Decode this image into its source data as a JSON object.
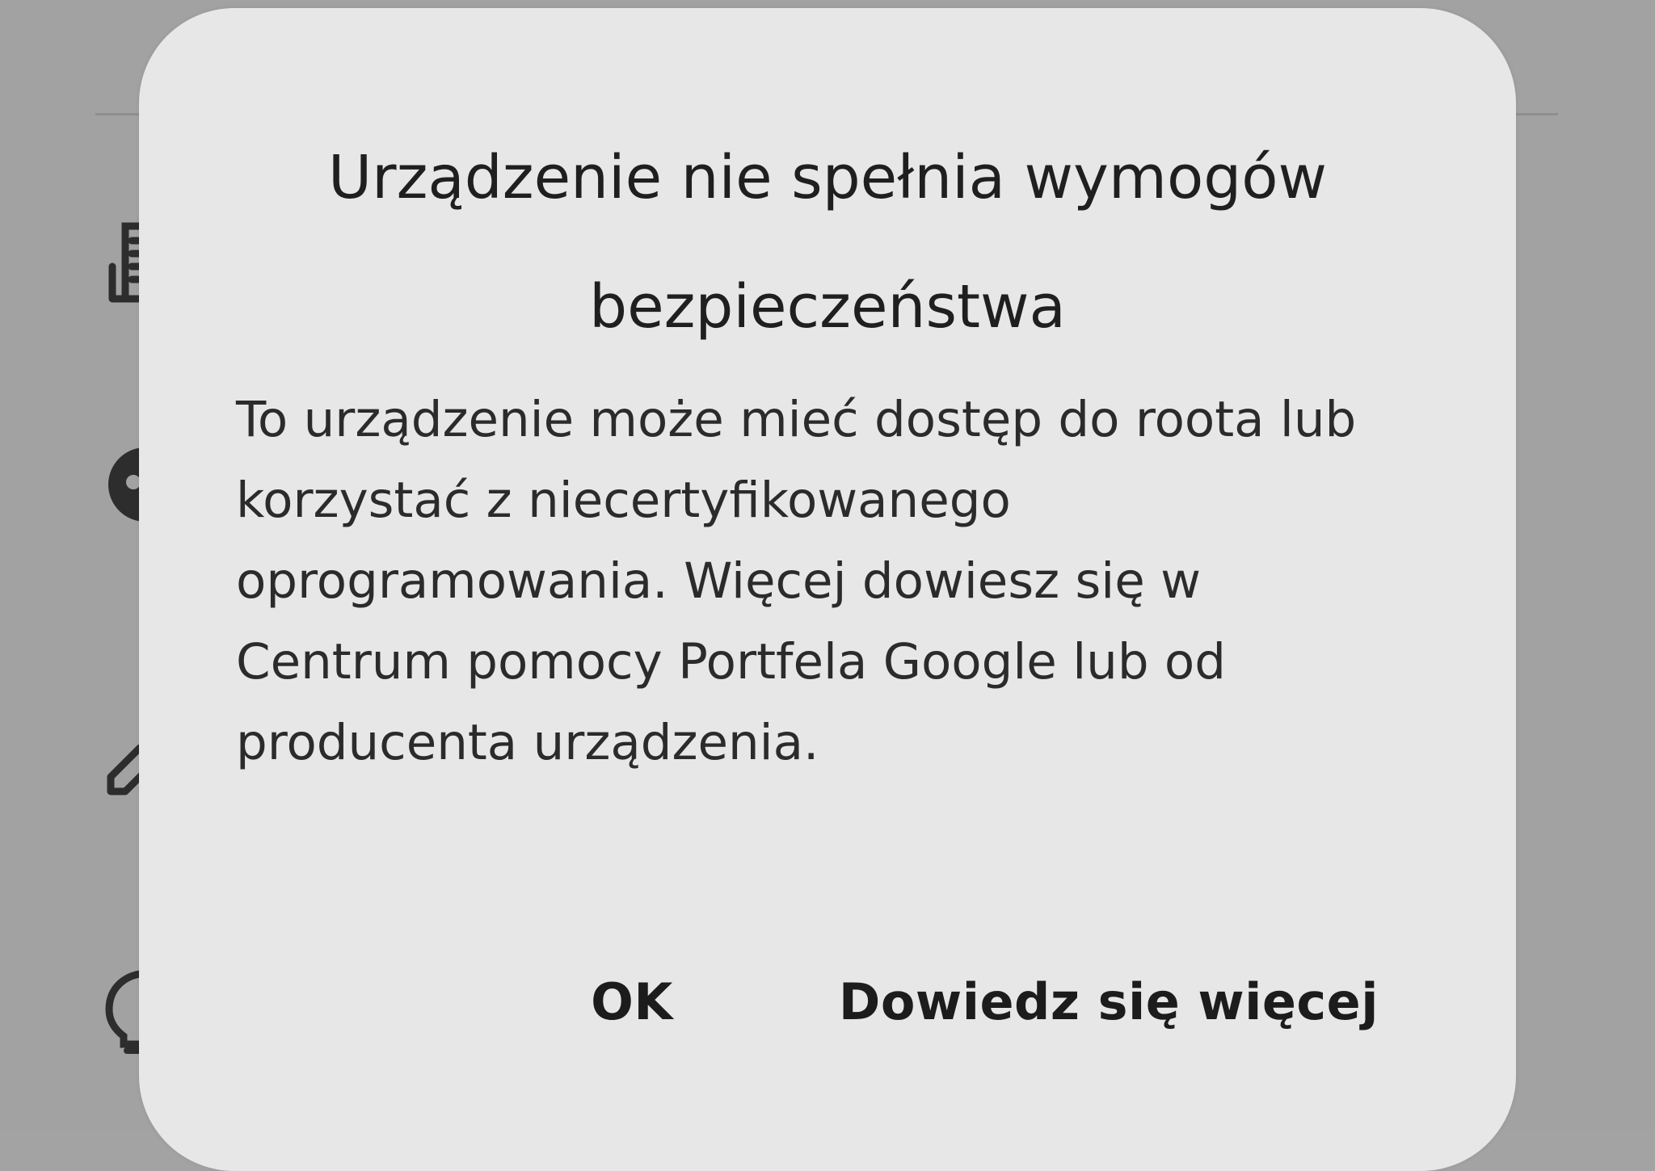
{
  "background": {
    "icons": [
      "building-icon",
      "account-circle-icon",
      "pencil-icon",
      "lightbulb-icon"
    ]
  },
  "dialog": {
    "title": "Urządzenie nie spełnia wymogów bezpieczeństwa",
    "body": "To urządzenie może mieć dostęp do roota lub korzystać z niecertyfikowanego oprogramowania. Więcej dowiesz się w Centrum pomocy Portfela Google lub od producenta urządzenia.",
    "actions": {
      "ok_label": "OK",
      "learn_more_label": "Dowiedz się więcej"
    }
  },
  "colors": {
    "scrim": "#a3a3a3",
    "dialog_surface": "#e7e7e7",
    "text": "#1f1f1f"
  }
}
